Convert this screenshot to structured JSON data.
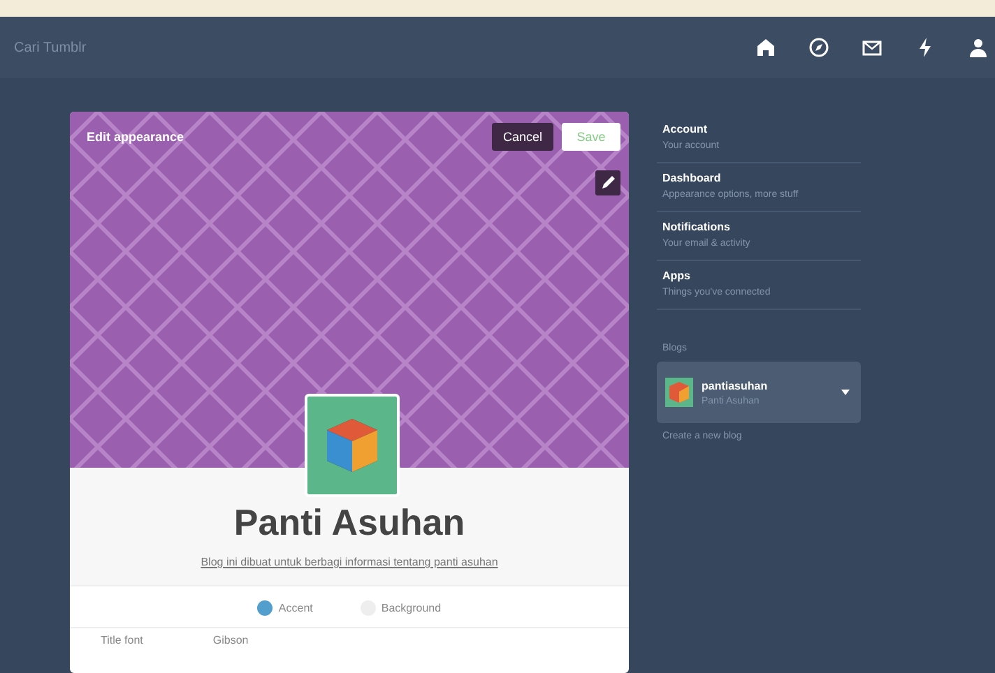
{
  "search": {
    "placeholder": "Cari Tumblr"
  },
  "nav_icons": [
    {
      "kind": "home"
    },
    {
      "kind": "compass"
    },
    {
      "kind": "mail"
    },
    {
      "kind": "bolt"
    },
    {
      "kind": "person"
    }
  ],
  "editor": {
    "title": "Edit appearance",
    "buttons": [
      {
        "label": "Cancel",
        "kind": "dark"
      },
      {
        "label": "Save",
        "kind": "light"
      }
    ],
    "blog_title": "Panti Asuhan",
    "description": "Blog ini dibuat untuk berbagi informasi tentang panti asuhan",
    "options": [
      {
        "label": "Accent",
        "selected": true
      },
      {
        "label": "Background",
        "selected": false
      }
    ],
    "field": {
      "label": "Title font",
      "value": "Gibson"
    }
  },
  "settings": [
    {
      "title": "Account",
      "subtitle": "Your account"
    },
    {
      "title": "Dashboard",
      "subtitle": "Appearance options, more stuff"
    },
    {
      "title": "Notifications",
      "subtitle": "Your email & activity"
    },
    {
      "title": "Apps",
      "subtitle": "Things you've connected"
    }
  ],
  "blogs_heading": "Blogs",
  "blog": {
    "name": "pantiasuhan",
    "subtitle": "Panti Asuhan"
  },
  "create_link": "Create a new blog"
}
